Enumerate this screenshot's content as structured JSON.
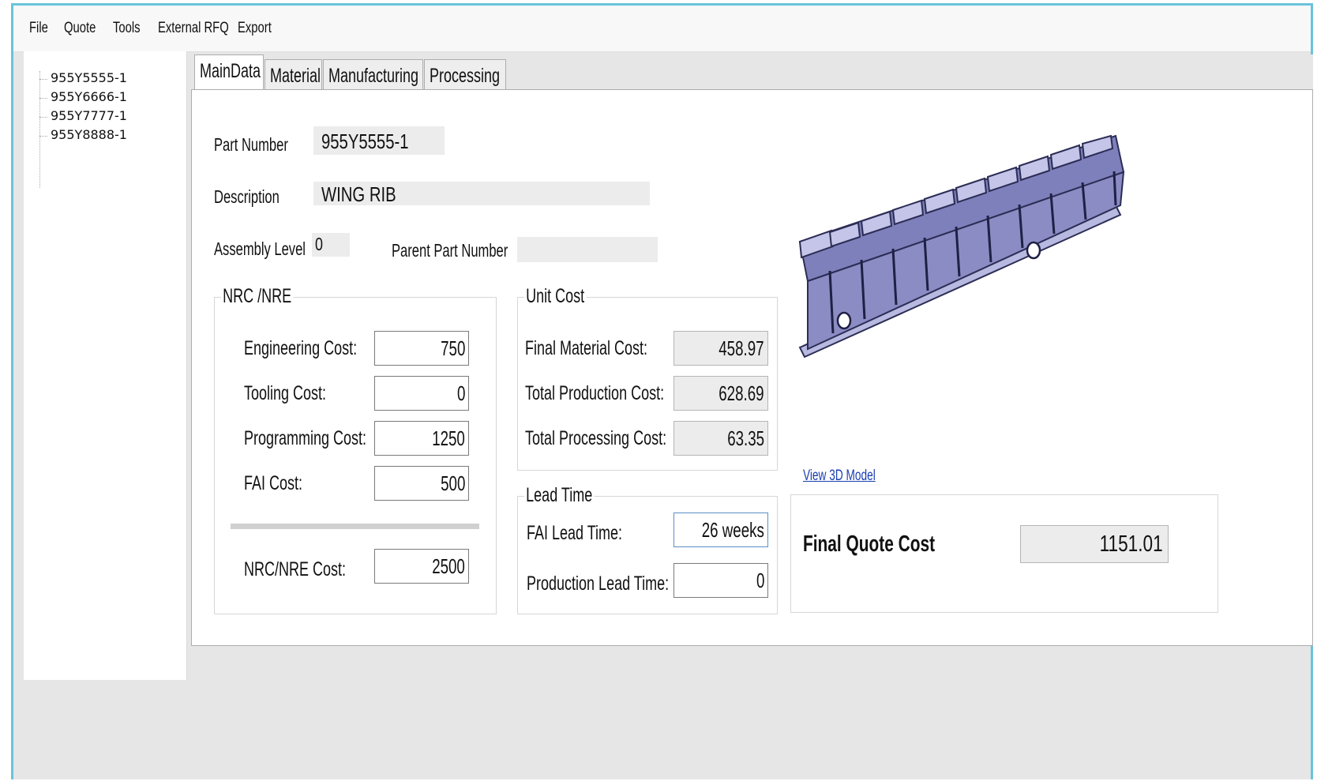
{
  "menu": {
    "file": "File",
    "quote": "Quote",
    "tools": "Tools",
    "external_rfq": "External RFQ",
    "export": "Export"
  },
  "tree": {
    "items": [
      "955Y5555-1",
      "955Y6666-1",
      "955Y7777-1",
      "955Y8888-1"
    ]
  },
  "tabs": {
    "maindata": "MainData",
    "material": "Material",
    "manufacturing": "Manufacturing",
    "processing": "Processing",
    "active": "MainData"
  },
  "main": {
    "part_number_label": "Part Number",
    "part_number_value": "955Y5555-1",
    "description_label": "Description",
    "description_value": "WING RIB",
    "assembly_level_label": "Assembly Level",
    "assembly_level_value": "0",
    "parent_part_number_label": "Parent Part Number",
    "parent_part_number_value": ""
  },
  "nrc": {
    "title": "NRC /NRE",
    "engineering_cost_label": "Engineering Cost:",
    "engineering_cost_value": "750",
    "tooling_cost_label": "Tooling Cost:",
    "tooling_cost_value": "0",
    "programming_cost_label": "Programming Cost:",
    "programming_cost_value": "1250",
    "fai_cost_label": "FAI Cost:",
    "fai_cost_value": "500",
    "nrc_nre_cost_label": "NRC/NRE Cost:",
    "nrc_nre_cost_value": "2500"
  },
  "unit_cost": {
    "title": "Unit Cost",
    "final_material_cost_label": "Final Material Cost:",
    "final_material_cost_value": "458.97",
    "total_production_cost_label": "Total Production Cost:",
    "total_production_cost_value": "628.69",
    "total_processing_cost_label": "Total Processing Cost:",
    "total_processing_cost_value": "63.35"
  },
  "lead_time": {
    "title": "Lead Time",
    "fai_lead_time_label": "FAI Lead Time:",
    "fai_lead_time_value": "26 weeks",
    "production_lead_time_label": "Production Lead Time:",
    "production_lead_time_value": "0"
  },
  "model": {
    "view_link": "View 3D Model",
    "part_color": "#8b8cc4"
  },
  "final": {
    "label": "Final Quote Cost",
    "value": "1151.01"
  },
  "colors": {
    "window_border": "#6ac3dc",
    "link": "#1a3fb0",
    "readonly_bg": "#ececec"
  }
}
